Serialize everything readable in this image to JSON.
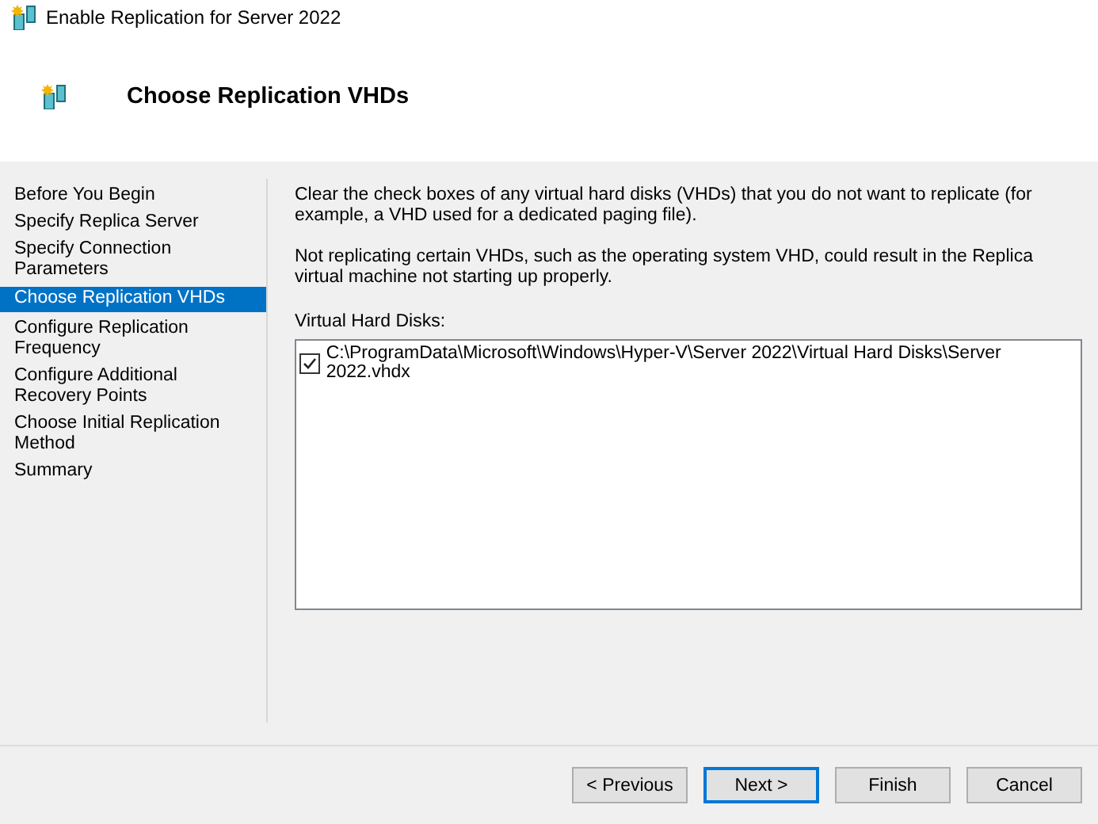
{
  "window": {
    "title": "Enable Replication for Server 2022"
  },
  "header": {
    "title": "Choose Replication VHDs"
  },
  "steps": [
    {
      "label": "Before You Begin",
      "selected": false
    },
    {
      "label": "Specify Replica Server",
      "selected": false
    },
    {
      "label": "Specify Connection Parameters",
      "selected": false
    },
    {
      "label": "Choose Replication VHDs",
      "selected": true
    },
    {
      "label": "Configure Replication Frequency",
      "selected": false
    },
    {
      "label": "Configure Additional Recovery Points",
      "selected": false
    },
    {
      "label": "Choose Initial Replication Method",
      "selected": false
    },
    {
      "label": "Summary",
      "selected": false
    }
  ],
  "paragraphs": [
    "Clear the check boxes of any virtual hard disks (VHDs) that you do not want to replicate (for example, a VHD used for a dedicated paging file).",
    "Not replicating certain VHDs, such as the operating system VHD, could result in the Replica virtual machine not starting up properly."
  ],
  "disks_label": "Virtual Hard Disks:",
  "disks": [
    {
      "path": "C:\\ProgramData\\Microsoft\\Windows\\Hyper-V\\Server 2022\\Virtual Hard Disks\\Server 2022.vhdx",
      "checked": true
    }
  ],
  "buttons": [
    {
      "label": "< Previous",
      "focused": false
    },
    {
      "label": "Next >",
      "focused": true
    },
    {
      "label": "Finish",
      "focused": false
    },
    {
      "label": "Cancel",
      "focused": false
    }
  ]
}
